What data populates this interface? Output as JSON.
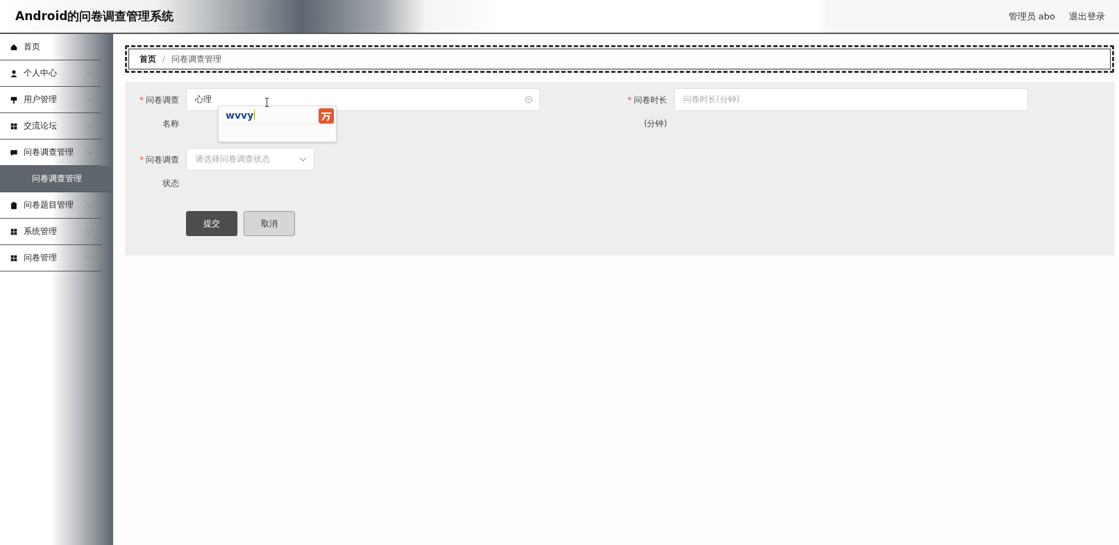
{
  "header": {
    "title": "Android的问卷调查管理系统",
    "user": "管理员 abo",
    "logout": "退出登录"
  },
  "sidebar": {
    "items": [
      {
        "label": "首页",
        "kind": "link"
      },
      {
        "label": "个人中心",
        "kind": "group"
      },
      {
        "label": "用户管理",
        "kind": "group"
      },
      {
        "label": "交流论坛",
        "kind": "group"
      },
      {
        "label": "问卷调查管理",
        "kind": "group",
        "children": [
          {
            "label": "问卷调查管理",
            "selected": true
          }
        ]
      },
      {
        "label": "问卷题目管理",
        "kind": "group"
      },
      {
        "label": "系统管理",
        "kind": "group"
      },
      {
        "label": "问卷管理",
        "kind": "group"
      }
    ]
  },
  "breadcrumb": {
    "separator": "/",
    "items": [
      "首页",
      "问卷调查管理"
    ]
  },
  "form": {
    "required_mark": "*",
    "fields": [
      {
        "kind": "text",
        "label": "问卷调查名称",
        "required": true,
        "value": "心理",
        "clearable": true,
        "ime": {
          "composition": "wvvy"
        }
      },
      {
        "kind": "text",
        "label": "问卷时长(分钟)",
        "required": true,
        "placeholder": "问卷时长(分钟)"
      },
      {
        "kind": "select",
        "label": "问卷调查状态",
        "required": true,
        "placeholder": "请选择问卷调查状态"
      }
    ],
    "buttons": [
      {
        "label": "提交",
        "kind": "primary"
      },
      {
        "label": "取消",
        "kind": "secondary"
      }
    ]
  }
}
